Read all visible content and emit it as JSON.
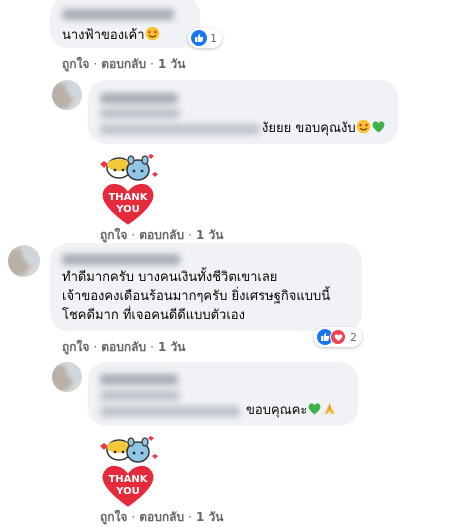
{
  "actions": {
    "like": "ถูกใจ",
    "reply": "ตอบกลับ",
    "separator": "·"
  },
  "comments": [
    {
      "text": "นางฟ้าของเค้า",
      "emoji": "heart-eyes",
      "reaction_count": "1",
      "time": "1 วัน"
    },
    {
      "text": "งัยยย ขอบคุณงับ",
      "emoji": "heart-eyes + green-heart",
      "time": null
    },
    {
      "sticker_label": "THANK YOU",
      "time": "1 วัน"
    },
    {
      "lines": [
        "ทำดีมากครับ บางคนเงินทั้งชีวิตเขาเลย",
        "เจ้าของคงเดือนร้อนมากๆครับ ยิ่งเศรษฐกิจแบบนี้",
        "โชคดีมาก ที่เจอคนดีดีแบบตัวเอง"
      ],
      "reaction_count": "2",
      "time": "1 วัน"
    },
    {
      "text": "ขอบคุณคะ",
      "emoji": "green-heart + folded-hands"
    },
    {
      "sticker_label": "THANK YOU",
      "time": "1 วัน"
    }
  ],
  "colors": {
    "bubble": "#f0f2f5",
    "like": "#1877f2",
    "love": "#f33e58",
    "meta": "#65676b",
    "text": "#050505"
  },
  "icons": [
    "like-icon",
    "love-icon",
    "heart-eyes-emoji",
    "green-heart-emoji",
    "folded-hands-emoji",
    "thank-you-sticker"
  ]
}
